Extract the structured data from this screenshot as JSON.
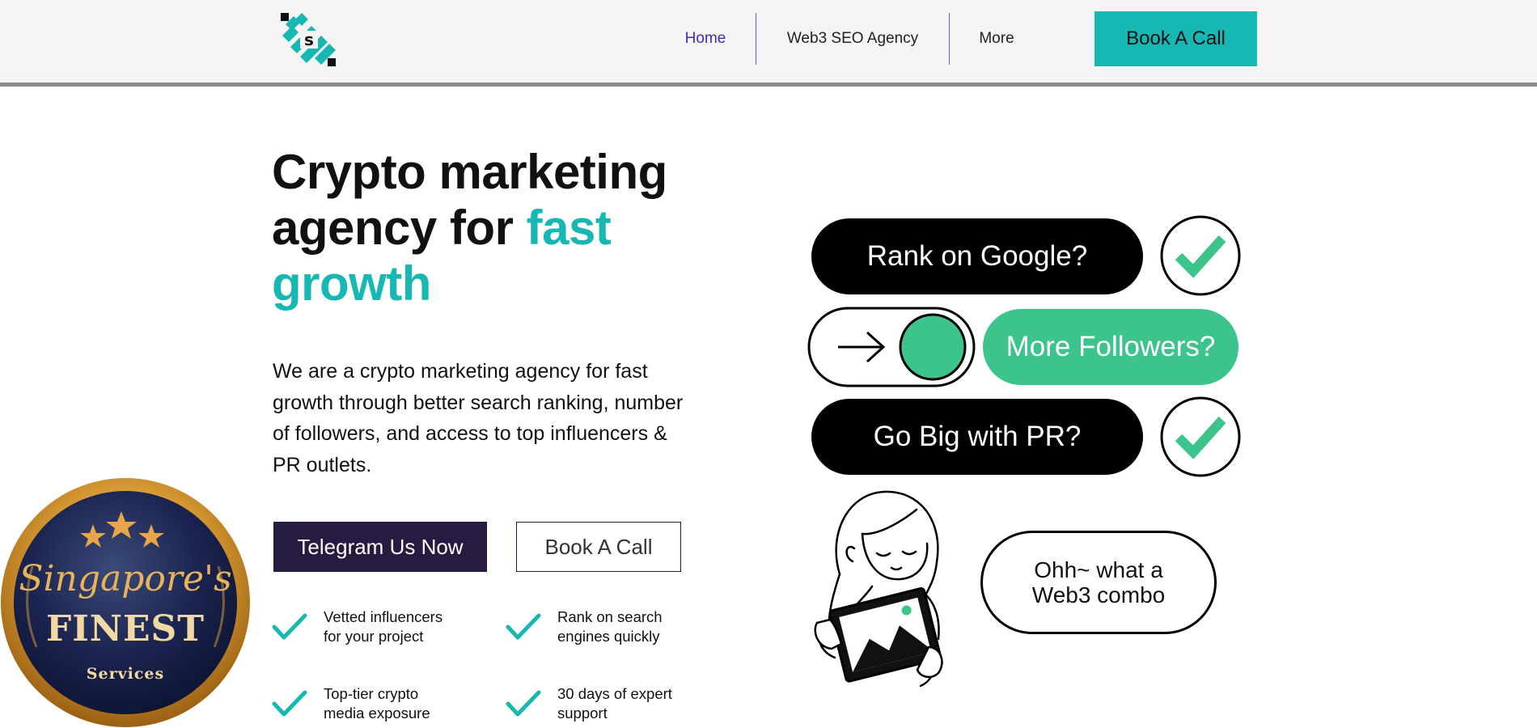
{
  "nav": {
    "items": [
      {
        "label": "Home"
      },
      {
        "label": "Web3 SEO Agency"
      },
      {
        "label": "More"
      }
    ],
    "cta_label": "Book A Call",
    "logo_letter": "s"
  },
  "hero": {
    "headline_part1": "Crypto marketing",
    "headline_part2": "agency for",
    "headline_accent_1": "fast",
    "headline_accent_2": "growth",
    "lead": "We are a crypto marketing agency for fast growth through better search ranking, number of followers, and access to top influencers & PR outlets.",
    "primary_button": "Telegram Us Now",
    "secondary_button": "Book A Call",
    "features": [
      {
        "line1": "Vetted influencers",
        "line2": "for your project"
      },
      {
        "line1": "Rank on search",
        "line2": "engines quickly"
      },
      {
        "line1": "Top-tier crypto",
        "line2": "media exposure"
      },
      {
        "line1": "30 days of expert",
        "line2": "support"
      }
    ]
  },
  "badge": {
    "script": "Singapore's",
    "title": "FINEST",
    "subtitle": "Services"
  },
  "illustration": {
    "pill_google": "Rank on Google?",
    "pill_followers": "More Followers?",
    "pill_pr": "Go Big with PR?",
    "combo_line1": "Ohh~ what a",
    "combo_line2": "Web3 combo"
  },
  "colors": {
    "accent": "#17b8b3",
    "nav_active": "#4a2bb0",
    "primary_dark": "#271b42",
    "green": "#3cc48c"
  }
}
